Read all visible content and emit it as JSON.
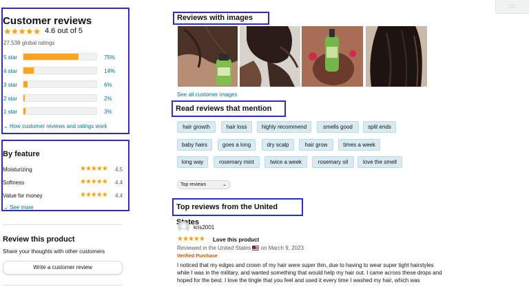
{
  "customer_reviews": {
    "title": "Customer reviews",
    "stars": "★★★★★",
    "rating_text": "4.6 out of 5",
    "global_ratings": "27,538 global ratings",
    "histogram": [
      {
        "label": "5 star",
        "percent_text": "75%",
        "percent": 75
      },
      {
        "label": "4 star",
        "percent_text": "14%",
        "percent": 14
      },
      {
        "label": "3 star",
        "percent_text": "6%",
        "percent": 6
      },
      {
        "label": "2 star",
        "percent_text": "2%",
        "percent": 2
      },
      {
        "label": "1 star",
        "percent_text": "3%",
        "percent": 3
      }
    ],
    "how_link": "How customer reviews and ratings work"
  },
  "by_feature": {
    "title": "By feature",
    "items": [
      {
        "name": "Moisturizing",
        "stars": "★★★★★",
        "value": "4.5"
      },
      {
        "name": "Softness",
        "stars": "★★★★★",
        "value": "4.4"
      },
      {
        "name": "Value for money",
        "stars": "★★★★★",
        "value": "4.4"
      }
    ],
    "see_more": "See more"
  },
  "review_product": {
    "title": "Review this product",
    "subtitle": "Share your thoughts with other customers",
    "button": "Write a customer review"
  },
  "reviews_with_images": {
    "title": "Reviews with images",
    "see_all": "See all customer images"
  },
  "mentions": {
    "title": "Read reviews that mention",
    "chips": [
      "hair growth",
      "hair loss",
      "highly recommend",
      "smells good",
      "split ends",
      "baby hairs",
      "goes a long",
      "dry scalp",
      "hair grow",
      "times a week",
      "long way",
      "rosemary mint",
      "twice a week",
      "rosemary oil",
      "love the smell"
    ]
  },
  "sort": {
    "selected": "Top reviews"
  },
  "top_reviews": {
    "title": "Top reviews from the United States",
    "review": {
      "author": "kris2001",
      "stars": "★★★★★",
      "headline": "Love this product",
      "date_prefix": "Reviewed in the United States",
      "date_suffix": "on March 9, 2023",
      "verified": "Verified Purchase",
      "body": "I noticed that my edges and crown of my hair were super thin, due to having to wear super tight hairstyles while I was in the military, and wanted something that would help my hair out. I came across these drops and hoped for the best. I love the tingle that you feel and used it every time I washed my hair, which was"
    }
  },
  "colors": {
    "accent_box": "#2b2bd6",
    "star": "#f5a300",
    "bar_fill": "#ffa41c",
    "link": "#007185",
    "chip_bg": "#d9ebf2"
  }
}
